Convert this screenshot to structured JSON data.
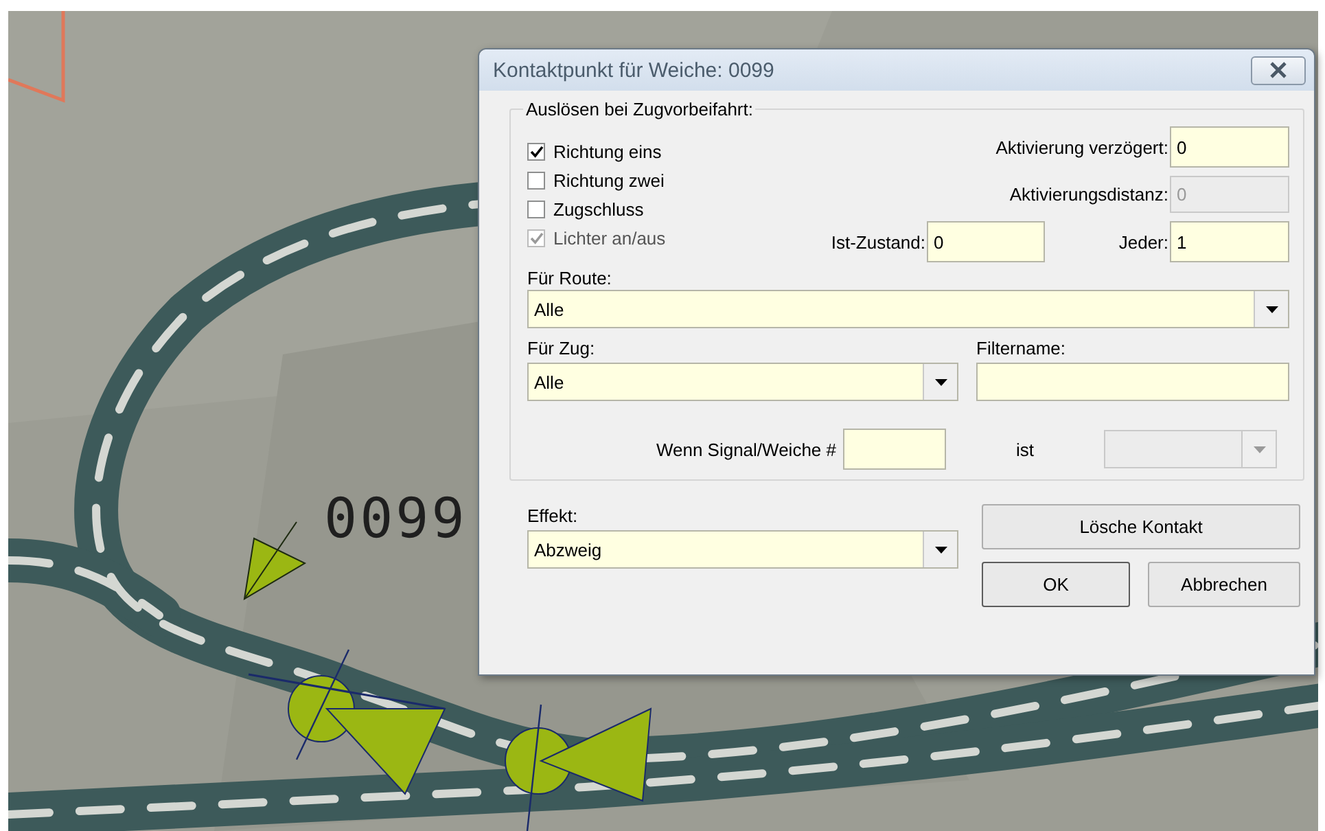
{
  "canvas": {
    "label": "0099"
  },
  "dialog": {
    "title": "Kontaktpunkt für Weiche: 0099",
    "group": {
      "title": "Auslösen bei Zugvorbeifahrt:",
      "checkboxes": [
        {
          "label": "Richtung eins",
          "checked": true,
          "disabled": false
        },
        {
          "label": "Richtung zwei",
          "checked": false,
          "disabled": false
        },
        {
          "label": "Zugschluss",
          "checked": false,
          "disabled": false
        },
        {
          "label": "Lichter an/aus",
          "checked": true,
          "disabled": true
        }
      ],
      "fields": [
        {
          "label": "Aktivierung verzögert:",
          "value": "0",
          "disabled": false
        },
        {
          "label": "Aktivierungsdistanz:",
          "value": "0",
          "disabled": true
        },
        {
          "label": "Ist-Zustand:",
          "value": "0",
          "disabled": false
        },
        {
          "label": "Jeder:",
          "value": "1",
          "disabled": false
        }
      ],
      "route": {
        "label": "Für Route:",
        "value": "Alle"
      },
      "train": {
        "label": "Für Zug:",
        "value": "Alle"
      },
      "filter": {
        "label": "Filtername:"
      },
      "condition": {
        "label": "Wenn Signal/Weiche #",
        "connector": "ist",
        "select_disabled": true
      }
    },
    "effect": {
      "label": "Effekt:",
      "value": "Abzweig"
    },
    "buttons": [
      {
        "label": "Lösche Kontakt",
        "kind": "wide"
      },
      {
        "label": "OK",
        "kind": "default"
      },
      {
        "label": "Abbrechen",
        "kind": "normal"
      }
    ]
  }
}
